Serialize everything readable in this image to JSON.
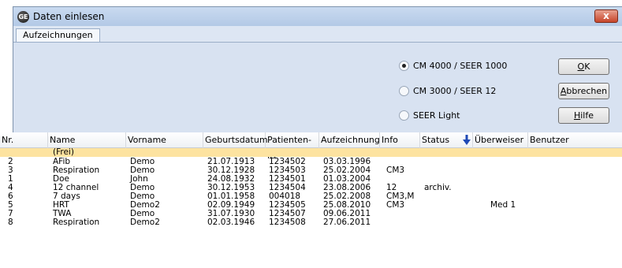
{
  "window": {
    "title": "Daten einlesen",
    "app_icon_label": "GE",
    "close_label": "x"
  },
  "tabs": [
    {
      "label": "Aufzeichnungen"
    }
  ],
  "options": {
    "selected": "CM 4000 / SEER 1000",
    "items": [
      {
        "label": "CM 4000 / SEER 1000",
        "checked": true
      },
      {
        "label": "CM 3000 / SEER 12",
        "checked": false
      },
      {
        "label": "SEER Light",
        "checked": false
      }
    ]
  },
  "buttons": {
    "ok": {
      "accel": "O",
      "rest": "K"
    },
    "cancel": {
      "accel": "A",
      "rest": "bbrechen"
    },
    "help": {
      "accel": "H",
      "rest": "ilfe"
    }
  },
  "table": {
    "columns": [
      "Nr.",
      "Name",
      "Vorname",
      "Geburtsdatum",
      "Patienten-ID",
      "Aufzeichnung",
      "Info",
      "Status",
      "Überweiser",
      "Benutzer"
    ],
    "sort_icon": "sort-down-arrow-icon",
    "rows": [
      {
        "nr": "",
        "name": "(Frei)",
        "vorname": "",
        "geburtsdatum": "",
        "patid": "",
        "aufz": "",
        "info": "",
        "status": "",
        "ueberweiser": "",
        "benutzer": "",
        "selected": true
      },
      {
        "nr": "2",
        "name": "AFib",
        "vorname": "Demo",
        "geburtsdatum": "21.07.1913",
        "patid": "1234502",
        "aufz": "03.03.1996",
        "info": "",
        "status": "",
        "ueberweiser": "",
        "benutzer": ""
      },
      {
        "nr": "3",
        "name": "Respiration",
        "vorname": "Demo",
        "geburtsdatum": "30.12.1928",
        "patid": "1234503",
        "aufz": "25.02.2004",
        "info": "CM3",
        "status": "",
        "ueberweiser": "",
        "benutzer": ""
      },
      {
        "nr": "1",
        "name": "Doe",
        "vorname": "John",
        "geburtsdatum": "24.08.1932",
        "patid": "1234501",
        "aufz": "01.03.2004",
        "info": "",
        "status": "",
        "ueberweiser": "",
        "benutzer": ""
      },
      {
        "nr": "4",
        "name": "12 channel",
        "vorname": "Demo",
        "geburtsdatum": "30.12.1953",
        "patid": "1234504",
        "aufz": "23.08.2006",
        "info": "12",
        "status": "archiv.",
        "ueberweiser": "",
        "benutzer": ""
      },
      {
        "nr": "6",
        "name": "7 days",
        "vorname": "Demo",
        "geburtsdatum": "01.01.1958",
        "patid": "004018",
        "aufz": "25.02.2008",
        "info": "CM3,M",
        "status": "",
        "ueberweiser": "",
        "benutzer": ""
      },
      {
        "nr": "5",
        "name": "HRT",
        "vorname": "Demo2",
        "geburtsdatum": "02.09.1949",
        "patid": "1234505",
        "aufz": "25.08.2010",
        "info": "CM3",
        "status": "",
        "ueberweiser": "Med 1",
        "benutzer": ""
      },
      {
        "nr": "7",
        "name": "TWA",
        "vorname": "Demo",
        "geburtsdatum": "31.07.1930",
        "patid": "1234507",
        "aufz": "09.06.2011",
        "info": "",
        "status": "",
        "ueberweiser": "",
        "benutzer": ""
      },
      {
        "nr": "8",
        "name": "Respiration",
        "vorname": "Demo2",
        "geburtsdatum": "02.03.1946",
        "patid": "1234508",
        "aufz": "27.06.2011",
        "info": "",
        "status": "",
        "ueberweiser": "",
        "benutzer": ""
      }
    ]
  },
  "colors": {
    "selected_row": "#fde3a0",
    "panel": "#d8e2f1",
    "close_button": "#c7452a"
  }
}
